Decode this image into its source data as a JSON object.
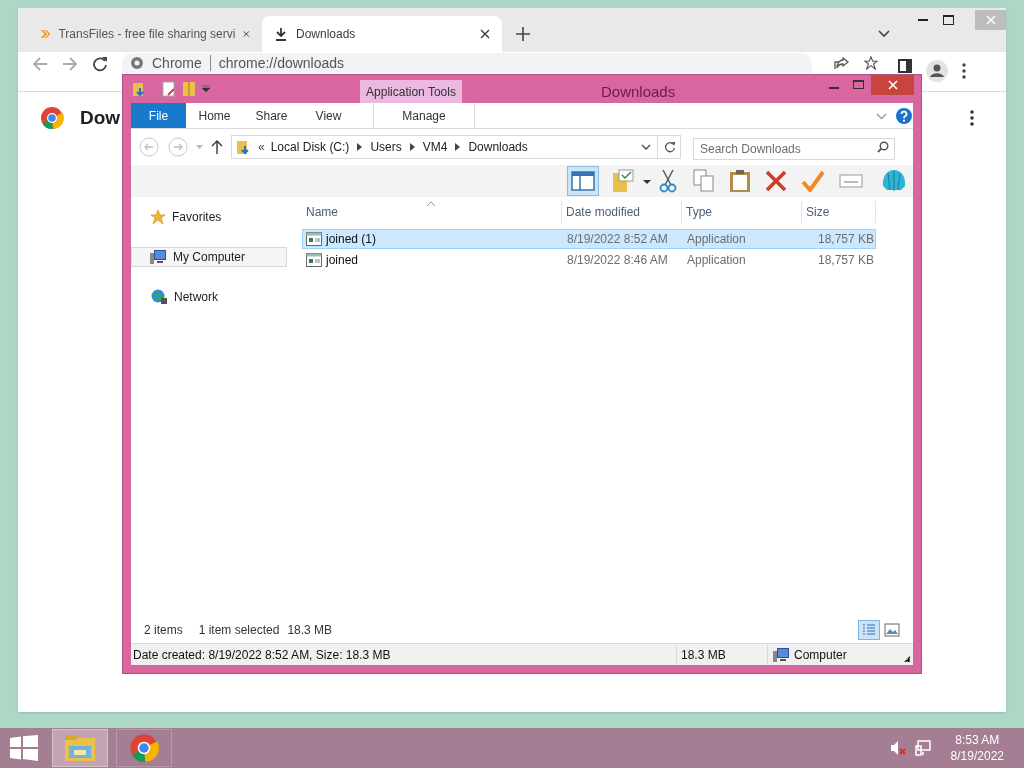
{
  "browser": {
    "tabs": [
      {
        "label": "TransFiles - free file sharing servi",
        "selected": false
      },
      {
        "label": "Downloads",
        "selected": true
      }
    ],
    "address": {
      "chip": "Chrome",
      "url": "chrome://downloads"
    },
    "page_title": "Dow"
  },
  "explorer": {
    "title": "Downloads",
    "context_group": "Application Tools",
    "ribbon_tabs": [
      {
        "label": "File",
        "kind": "file",
        "selected": false
      },
      {
        "label": "Home",
        "kind": "tab",
        "selected": false
      },
      {
        "label": "Share",
        "kind": "tab",
        "selected": false
      },
      {
        "label": "View",
        "kind": "tab",
        "selected": false
      },
      {
        "label": "Manage",
        "kind": "context",
        "selected": false
      }
    ],
    "breadcrumb_overflow": "«",
    "path": [
      "Local Disk (C:)",
      "Users",
      "VM4",
      "Downloads"
    ],
    "search": {
      "placeholder": "Search Downloads"
    },
    "nav": [
      {
        "label": "Favorites",
        "kind": "favorites",
        "selected": false
      },
      {
        "label": "My Computer",
        "kind": "computer",
        "selected": true
      },
      {
        "label": "Network",
        "kind": "network",
        "selected": false
      }
    ],
    "columns": [
      "Name",
      "Date modified",
      "Type",
      "Size"
    ],
    "rows": [
      {
        "name": "joined (1)",
        "date": "8/19/2022 8:52 AM",
        "type": "Application",
        "size": "18,757 KB",
        "selected": true
      },
      {
        "name": "joined",
        "date": "8/19/2022 8:46 AM",
        "type": "Application",
        "size": "18,757 KB",
        "selected": false
      }
    ],
    "status": {
      "items": "2 items",
      "selected": "1 item selected",
      "size": "18.3 MB"
    },
    "details": {
      "info": "Date created: 8/19/2022 8:52 AM, Size: 18.3 MB",
      "size": "18.3 MB",
      "zone": "Computer"
    }
  },
  "taskbar": {
    "time": "8:53 AM",
    "date": "8/19/2022"
  }
}
